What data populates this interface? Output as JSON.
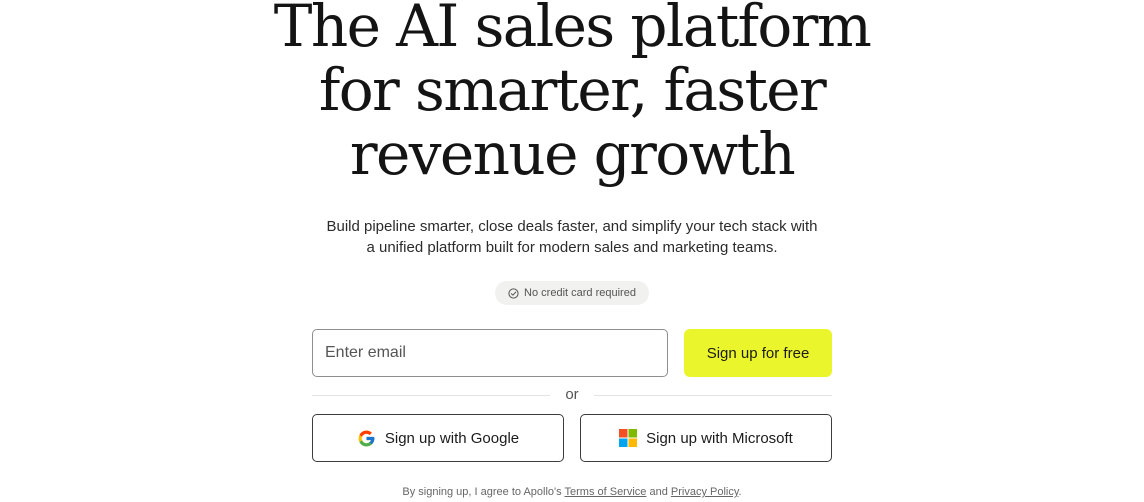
{
  "hero": {
    "headline_line1": "The AI sales platform",
    "headline_line2": "for smarter, faster",
    "headline_line3": "revenue growth",
    "subtitle_line1": "Build pipeline smarter, close deals faster, and simplify your tech stack with",
    "subtitle_line2": "a unified platform built for modern sales and marketing teams."
  },
  "badge": {
    "icon": "check-circle-icon",
    "text": "No credit card required"
  },
  "signup_form": {
    "email_placeholder": "Enter email",
    "email_value": "",
    "submit_label": "Sign up for free",
    "submit_color": "#ebf52c"
  },
  "divider": {
    "text": "or"
  },
  "sso": {
    "google_icon": "google-icon",
    "google_label": "Sign up with Google",
    "microsoft_icon": "microsoft-icon",
    "microsoft_label": "Sign up with Microsoft"
  },
  "legal": {
    "prefix": "By signing up, I agree to Apollo's ",
    "terms_label": "Terms of Service",
    "conjunction": " and ",
    "privacy_label": "Privacy Policy",
    "suffix": "."
  }
}
